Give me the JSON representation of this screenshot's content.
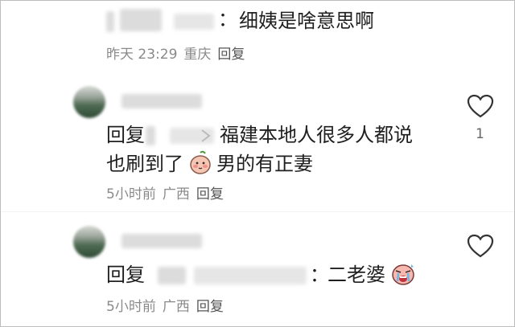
{
  "comments": [
    {
      "colon_text": "：",
      "text": "细姨是啥意思啊",
      "meta": {
        "time": "昨天 23:29",
        "location": "重庆",
        "reply": "回复"
      }
    },
    {
      "reply_prefix": "回复",
      "text_line1": "福建本地人很多人都说",
      "text_line2_a": "也刷到了",
      "text_line2_b": "男的有正妻",
      "meta": {
        "time": "5小时前",
        "location": "广西",
        "reply": "回复"
      },
      "likes": "1"
    },
    {
      "reply_prefix": "回复",
      "colon_text": "：",
      "text": "二老婆",
      "meta": {
        "time": "5小时前",
        "location": "广西",
        "reply": "回复"
      }
    }
  ],
  "icons": {
    "like": "heart-outline-icon",
    "emoji_shy": "blushing-face-emoji",
    "emoji_cry": "crying-face-emoji"
  },
  "colors": {
    "text": "#1f1f1f",
    "meta": "#8a8a8a",
    "icon": "#333333"
  }
}
